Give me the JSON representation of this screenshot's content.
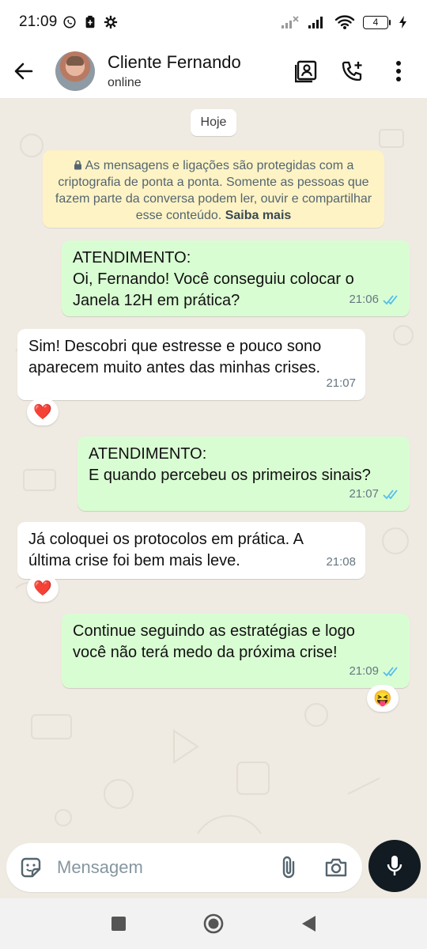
{
  "status_bar": {
    "time": "21:09",
    "left_icons": [
      "whatsapp-status-icon",
      "battery-saver-icon",
      "gear-icon"
    ],
    "right_icons": [
      "signal-weak-icon",
      "signal-icon",
      "wifi-icon",
      "battery-icon",
      "charging-icon"
    ],
    "battery_level": "4"
  },
  "header": {
    "contact_name": "Cliente Fernando",
    "contact_status": "online",
    "actions": [
      "contact-card-icon",
      "add-call-icon",
      "more-icon"
    ]
  },
  "chat": {
    "date_chip": "Hoje",
    "encryption_notice": {
      "text": "As mensagens e ligações são protegidas com a criptografia de ponta a ponta. Somente as pessoas que fazem parte da conversa podem ler, ouvir e compartilhar esse conteúdo.",
      "link": "Saiba mais"
    },
    "messages": [
      {
        "direction": "out",
        "line1": "ATENDIMENTO:",
        "line2": "Oi, Fernando! Você conseguiu colocar o",
        "line3": "Janela 12H em prática?",
        "time": "21:06",
        "status": "read"
      },
      {
        "direction": "in",
        "line1": "Sim! Descobri que estresse e pouco sono",
        "line2": "aparecem muito antes das minhas crises.",
        "time": "21:07",
        "reaction": "❤️"
      },
      {
        "direction": "out",
        "line1": "ATENDIMENTO:",
        "line2": "E quando percebeu os primeiros sinais?",
        "time": "21:07",
        "status": "read"
      },
      {
        "direction": "in",
        "line1": "Já coloquei os protocolos em prática. A",
        "line2": "última crise foi bem mais leve.",
        "time": "21:08",
        "reaction": "❤️"
      },
      {
        "direction": "out",
        "line1": "Continue seguindo as estratégias e logo",
        "line2": "você não terá medo da próxima crise!",
        "time": "21:09",
        "status": "read",
        "reaction": "😝"
      }
    ]
  },
  "composer": {
    "placeholder": "Mensagem",
    "icons": [
      "sticker-icon",
      "attach-icon",
      "camera-icon",
      "mic-icon"
    ]
  },
  "navbar": {
    "buttons": [
      "recent-apps-icon",
      "home-icon",
      "back-nav-icon"
    ]
  },
  "colors": {
    "outgoing_bubble": "#d9fdd3",
    "incoming_bubble": "#ffffff",
    "chat_background": "#efeae2",
    "read_ticks": "#53bdeb",
    "encryption_bg": "#fdf3c5",
    "mic_button": "#111b21"
  }
}
